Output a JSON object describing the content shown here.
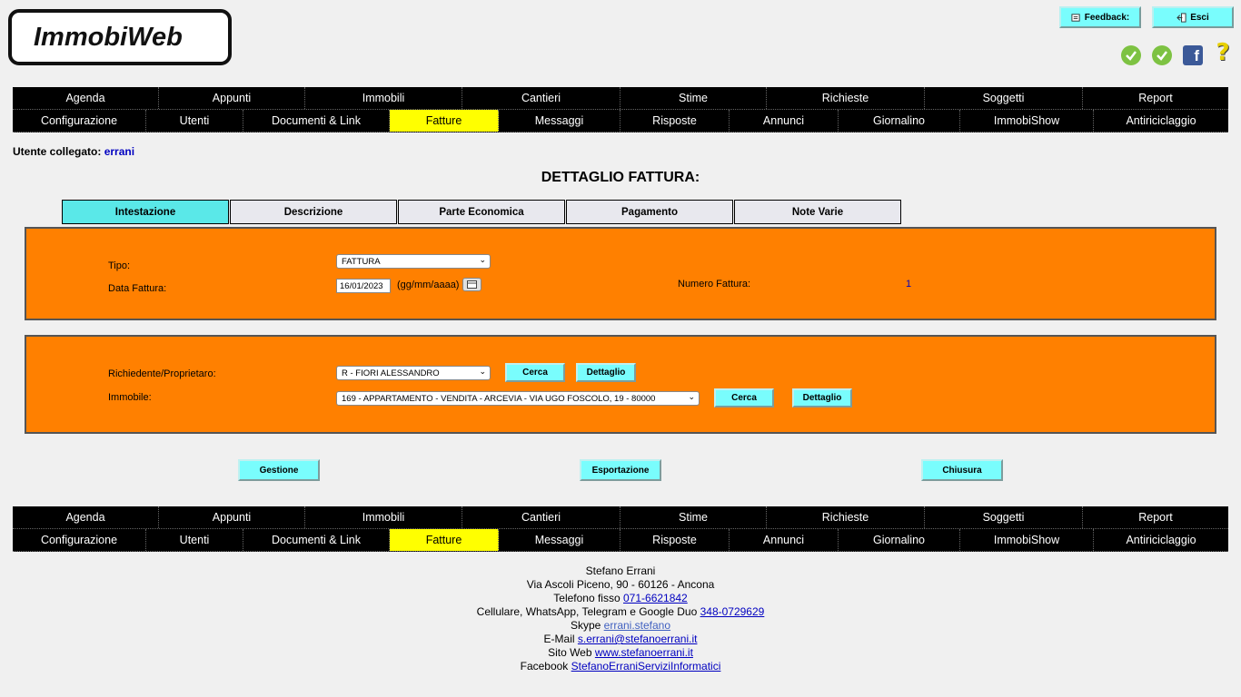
{
  "logo": {
    "text": "ImmobiWeb"
  },
  "top_buttons": {
    "feedback": "Feedback:",
    "exit": "Esci"
  },
  "icons": [
    "check-icon",
    "check-icon",
    "facebook-icon",
    "help-icon"
  ],
  "menu": {
    "row1": [
      "Agenda",
      "Appunti",
      "Immobili",
      "Cantieri",
      "Stime",
      "Richieste",
      "Soggetti",
      "Report"
    ],
    "row2": [
      "Configurazione",
      "Utenti",
      "Documenti & Link",
      "Fatture",
      "Messaggi",
      "Risposte",
      "Annunci",
      "Giornalino",
      "ImmobiShow",
      "Antiriciclaggio"
    ],
    "active": "Fatture",
    "active_color": "#ffff00"
  },
  "user": {
    "label": "Utente collegato:",
    "name": "errani"
  },
  "page_title": "DETTAGLIO FATTURA:",
  "tabs": [
    "Intestazione",
    "Descrizione",
    "Parte Economica",
    "Pagamento",
    "Note Varie"
  ],
  "active_tab": "Intestazione",
  "panel1": {
    "tipo_label": "Tipo:",
    "tipo_value": "FATTURA",
    "data_label": "Data Fattura:",
    "data_value": "16/01/2023",
    "data_hint": "(gg/mm/aaaa)",
    "numero_label": "Numero Fattura:",
    "numero_value": "1"
  },
  "panel2": {
    "richiedente_label": "Richiedente/Proprietaro:",
    "richiedente_value": "R - FIORI ALESSANDRO",
    "immobile_label": "Immobile:",
    "immobile_value": "169 - APPARTAMENTO - VENDITA - ARCEVIA - VIA UGO FOSCOLO, 19 - 80000",
    "cerca": "Cerca",
    "dettaglio": "Dettaglio"
  },
  "actions": {
    "gestione": "Gestione",
    "esportazione": "Esportazione",
    "chiusura": "Chiusura"
  },
  "colors": {
    "panel": "#ff8000",
    "button": "#79fdfd",
    "active_tab": "#5ae8e8"
  },
  "footer": {
    "name": "Stefano Errani",
    "address": "Via Ascoli Piceno, 90 - 60126 - Ancona",
    "phone_label": "Telefono fisso",
    "phone": "071-6621842",
    "mobile_label": "Cellulare, WhatsApp, Telegram e Google Duo",
    "mobile": "348-0729629",
    "skype_label": "Skype",
    "skype": "errani.stefano",
    "email_label": "E-Mail",
    "email": "s.errani@stefanoerrani.it",
    "web_label": "Sito Web",
    "web": "www.stefanoerrani.it",
    "facebook_label": "Facebook",
    "facebook": "StefanoErraniServiziInformatici"
  }
}
